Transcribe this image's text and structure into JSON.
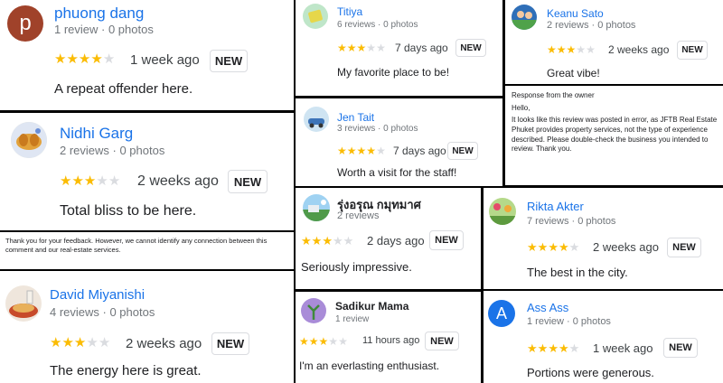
{
  "badge_label": "NEW",
  "reviews": [
    {
      "name": "phuong dang",
      "meta": "1 review · 0 photos",
      "rating": 4,
      "time": "1 week ago",
      "text": "A repeat offender here.",
      "avatar": {
        "type": "letter",
        "letter": "p",
        "color": "#a0422a"
      }
    },
    {
      "name": "Nidhi Garg",
      "meta": "2 reviews · 0 photos",
      "rating": 3,
      "time": "2 weeks ago",
      "text": "Total bliss to be here.",
      "avatar": {
        "type": "image",
        "icon": "bread-photo-icon"
      }
    },
    {
      "name": "David Miyanishi",
      "meta": "4 reviews · 0 photos",
      "rating": 3,
      "time": "2 weeks ago",
      "text": "The energy here is great.",
      "avatar": {
        "type": "image",
        "icon": "food-photo-icon"
      }
    },
    {
      "name": "Titiya",
      "meta": "6 reviews · 0 photos",
      "rating": 3,
      "time": "7 days ago",
      "text": "My favorite place to be!",
      "avatar": {
        "type": "image",
        "icon": "sticker-avatar-icon"
      }
    },
    {
      "name": "Jen Tait",
      "meta": "3 reviews · 0 photos",
      "rating": 4,
      "time": "7 days ago",
      "text": "Worth a visit for the staff!",
      "avatar": {
        "type": "image",
        "icon": "car-avatar-icon"
      }
    },
    {
      "name": "รุ่งอรุณ กมุทมาศ",
      "meta": "2 reviews",
      "rating": 3,
      "time": "2 days ago",
      "text": "Seriously impressive.",
      "avatar": {
        "type": "image",
        "icon": "landscape-avatar-icon"
      }
    },
    {
      "name": "Sadikur Mama",
      "meta": "1 review",
      "rating": 3,
      "time": "11 hours ago",
      "text": "I'm an everlasting enthusiast.",
      "avatar": {
        "type": "image",
        "icon": "plant-avatar-icon"
      }
    },
    {
      "name": "Keanu Sato",
      "meta": "2 reviews · 0 photos",
      "rating": 3,
      "time": "2 weeks ago",
      "text": "Great vibe!",
      "avatar": {
        "type": "image",
        "icon": "sports-avatar-icon"
      }
    },
    {
      "name": "Rikta Akter",
      "meta": "7 reviews · 0 photos",
      "rating": 4,
      "time": "2 weeks ago",
      "text": "The best in the city.",
      "avatar": {
        "type": "image",
        "icon": "garden-avatar-icon"
      }
    },
    {
      "name": "Ass Ass",
      "meta": "1 review · 0 photos",
      "rating": 4,
      "time": "1 week ago",
      "text": "Portions were generous.",
      "avatar": {
        "type": "letter",
        "letter": "A",
        "color": "#1a73e8"
      }
    }
  ],
  "replies": {
    "left": "Thank you for your feedback. However, we cannot identify any connection between this comment and our real-estate services.",
    "right_heading": "Response from the owner",
    "right_greeting": "Hello,",
    "right_body": "It looks like this review was posted in error, as JFTB Real Estate Phuket provides property services, not the type of experience described. Please double-check the business you intended to review. Thank you."
  }
}
